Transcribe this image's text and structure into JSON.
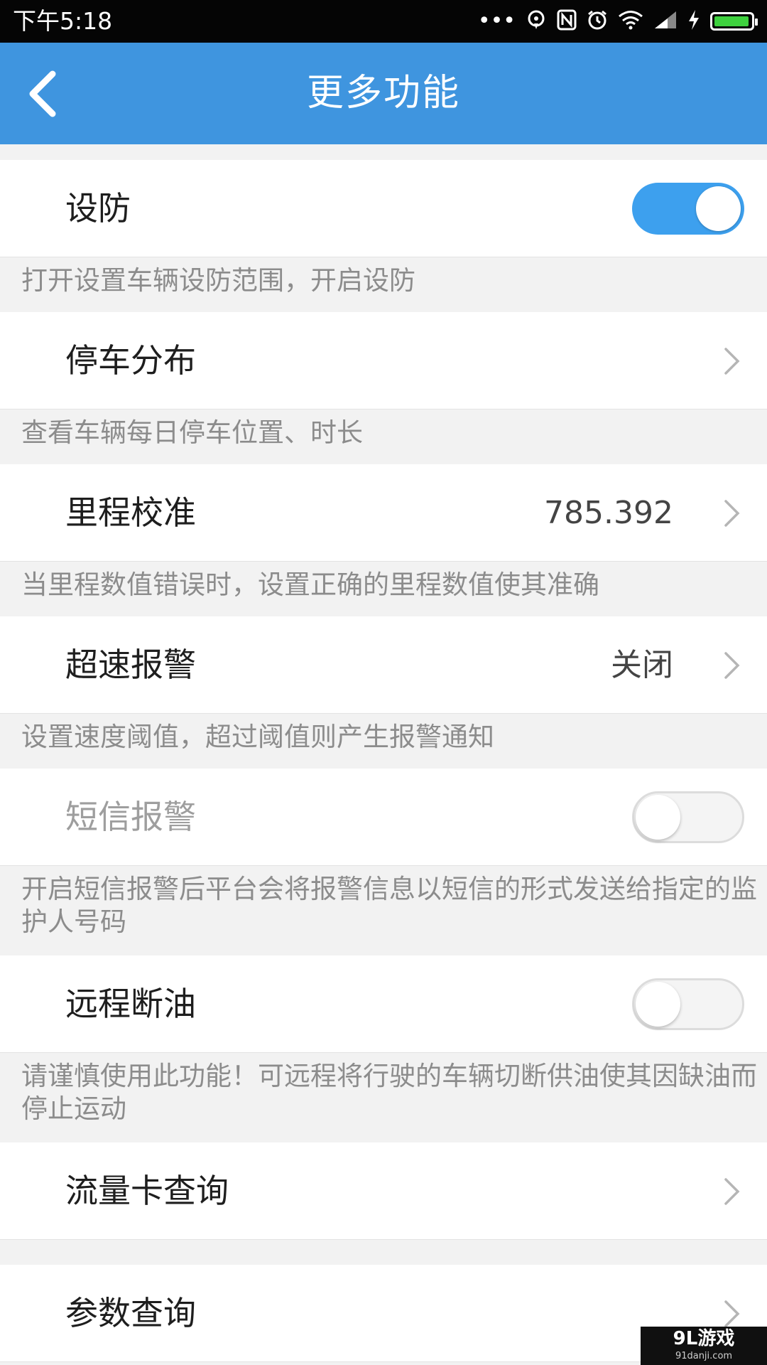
{
  "status_bar": {
    "time": "下午5:18",
    "dots": "•••"
  },
  "header": {
    "title": "更多功能"
  },
  "rows": {
    "arming": {
      "label": "设防",
      "switch_on": true,
      "description": "打开设置车辆设防范围，开启设防"
    },
    "parking": {
      "label": "停车分布",
      "description": "查看车辆每日停车位置、时长"
    },
    "mileage": {
      "label": "里程校准",
      "value": "785.392",
      "description": "当里程数值错误时，设置正确的里程数值使其准确"
    },
    "overspeed": {
      "label": "超速报警",
      "value": "关闭",
      "description": "设置速度阈值，超过阈值则产生报警通知"
    },
    "sms_alarm": {
      "label": "短信报警",
      "switch_on": false,
      "description": "开启短信报警后平台会将报警信息以短信的形式发送给指定的监护人号码"
    },
    "fuel_cut": {
      "label": "远程断油",
      "switch_on": false,
      "description": "请谨慎使用此功能！可远程将行驶的车辆切断供油使其因缺油而停止运动"
    },
    "data_card": {
      "label": "流量卡查询"
    },
    "params": {
      "label": "参数查询"
    }
  },
  "watermark": {
    "main": "9L游戏",
    "sub": "91danji.com"
  },
  "colors": {
    "app_bar": "#3f95df",
    "switch_on": "#3da0ee",
    "battery": "#3ed13e"
  }
}
